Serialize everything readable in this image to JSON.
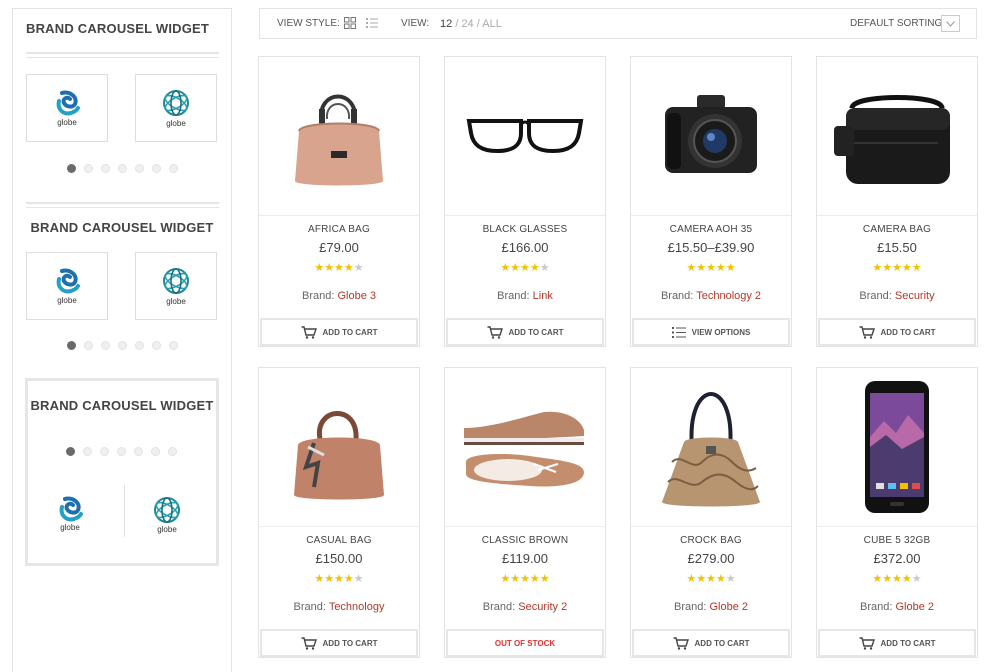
{
  "sidebar": {
    "widgets": [
      {
        "title": "BRAND CAROUSEL WIDGET",
        "logos": [
          {
            "label": "globe"
          },
          {
            "label": "globe"
          }
        ]
      },
      {
        "title": "BRAND CAROUSEL WIDGET",
        "logos": [
          {
            "label": "globe"
          },
          {
            "label": "globe"
          }
        ]
      },
      {
        "title": "BRAND CAROUSEL WIDGET",
        "logos": [
          {
            "label": "globe"
          },
          {
            "label": "globe"
          }
        ]
      }
    ]
  },
  "toolbar": {
    "view_style_label": "VIEW STYLE:",
    "view_label": "VIEW:",
    "view_options": [
      "12",
      "24",
      "ALL"
    ],
    "view_selected": "12",
    "separator": "/",
    "sorting_label": "DEFAULT SORTING"
  },
  "colors": {
    "brand_link": "#b0392b",
    "star": "#f2c200",
    "out_of_stock": "#dd3333"
  },
  "products": [
    {
      "name": "AFRICA BAG",
      "price": "£79.00",
      "rating": 4,
      "brand_label": "Brand:",
      "brand": "Globe 3",
      "button": "ADD TO CART",
      "button_icon": "cart-icon",
      "image": "tan-handbag"
    },
    {
      "name": "BLACK GLASSES",
      "price": "£166.00",
      "rating": 4,
      "brand_label": "Brand:",
      "brand": "Link",
      "button": "ADD TO CART",
      "button_icon": "cart-icon",
      "image": "black-glasses"
    },
    {
      "name": "CAMERA AOH 35",
      "price": "£15.50–£39.90",
      "rating": 5,
      "brand_label": "Brand:",
      "brand": "Technology 2",
      "button": "VIEW OPTIONS",
      "button_icon": "list-icon",
      "image": "dslr-camera"
    },
    {
      "name": "CAMERA BAG",
      "price": "£15.50",
      "rating": 5,
      "brand_label": "Brand:",
      "brand": "Security",
      "button": "ADD TO CART",
      "button_icon": "cart-icon",
      "image": "black-camera-bag"
    },
    {
      "name": "CASUAL BAG",
      "price": "£150.00",
      "rating": 4,
      "brand_label": "Brand:",
      "brand": "Technology",
      "button": "ADD TO CART",
      "button_icon": "cart-icon",
      "image": "brown-handbag"
    },
    {
      "name": "CLASSIC BROWN",
      "price": "£119.00",
      "rating": 5,
      "brand_label": "Brand:",
      "brand": "Security 2",
      "button": "OUT OF STOCK",
      "button_icon": "",
      "image": "brown-shoes"
    },
    {
      "name": "CROCK BAG",
      "price": "£279.00",
      "rating": 4,
      "brand_label": "Brand:",
      "brand": "Globe 2",
      "button": "ADD TO CART",
      "button_icon": "cart-icon",
      "image": "snakeskin-bag"
    },
    {
      "name": "CUBE 5 32GB",
      "price": "£372.00",
      "rating": 4,
      "brand_label": "Brand:",
      "brand": "Globe 2",
      "button": "ADD TO CART",
      "button_icon": "cart-icon",
      "image": "smartphone"
    }
  ]
}
